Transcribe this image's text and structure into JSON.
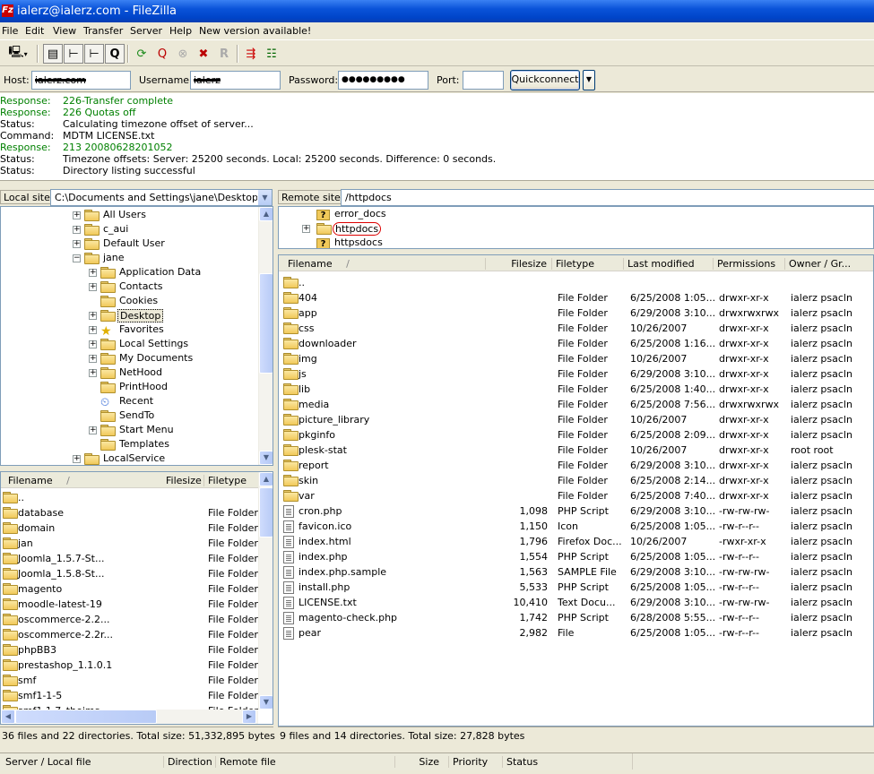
{
  "title": "ialerz@ialerz.com - FileZilla",
  "app_icon": "Fz",
  "menu": [
    "File",
    "Edit",
    "View",
    "Transfer",
    "Server",
    "Help",
    "New version available!"
  ],
  "toolbar_icons": [
    "site-manager-icon",
    "toggle-log-icon",
    "toggle-local-tree-icon",
    "toggle-remote-tree-icon",
    "toggle-queue-icon",
    "refresh-icon",
    "process-queue-icon",
    "cancel-icon",
    "disconnect-icon",
    "reconnect-icon",
    "compare-icon",
    "sync-browse-icon"
  ],
  "quickconnect": {
    "host_label": "Host:",
    "host_value": "ialerz.com",
    "username_label": "Username:",
    "username_value": "ialerz",
    "password_label": "Password:",
    "password_value": "●●●●●●●●●",
    "port_label": "Port:",
    "port_value": "",
    "button": "Quickconnect",
    "dropdown": "▼"
  },
  "log": [
    {
      "type": "Response:",
      "msg": "226-Transfer complete",
      "green": true
    },
    {
      "type": "Response:",
      "msg": "226 Quotas off",
      "green": true
    },
    {
      "type": "Status:",
      "msg": "Calculating timezone offset of server...",
      "green": false
    },
    {
      "type": "Command:",
      "msg": "MDTM LICENSE.txt",
      "green": false
    },
    {
      "type": "Response:",
      "msg": "213 20080628201052",
      "green": true
    },
    {
      "type": "Status:",
      "msg": "Timezone offsets: Server: 25200 seconds. Local: 25200 seconds. Difference: 0 seconds.",
      "green": false
    },
    {
      "type": "Status:",
      "msg": "Directory listing successful",
      "green": false
    }
  ],
  "local_site": {
    "label": "Local site:",
    "path": "C:\\Documents and Settings\\jane\\Desktop\\"
  },
  "remote_site": {
    "label": "Remote site:",
    "path": "/httpdocs"
  },
  "local_tree": [
    {
      "label": "All Users",
      "level": 0,
      "exp": "+",
      "icon": "folder"
    },
    {
      "label": "c_aui",
      "level": 0,
      "exp": "+",
      "icon": "folder"
    },
    {
      "label": "Default User",
      "level": 0,
      "exp": "+",
      "icon": "folder"
    },
    {
      "label": "jane",
      "level": 0,
      "exp": "−",
      "icon": "folder"
    },
    {
      "label": "Application Data",
      "level": 1,
      "exp": "+",
      "icon": "folder"
    },
    {
      "label": "Contacts",
      "level": 1,
      "exp": "+",
      "icon": "folder"
    },
    {
      "label": "Cookies",
      "level": 1,
      "exp": "",
      "icon": "folder"
    },
    {
      "label": "Desktop",
      "level": 1,
      "exp": "+",
      "icon": "folder",
      "selected": true
    },
    {
      "label": "Favorites",
      "level": 1,
      "exp": "+",
      "icon": "star"
    },
    {
      "label": "Local Settings",
      "level": 1,
      "exp": "+",
      "icon": "folder"
    },
    {
      "label": "My Documents",
      "level": 1,
      "exp": "+",
      "icon": "folder"
    },
    {
      "label": "NetHood",
      "level": 1,
      "exp": "+",
      "icon": "folder"
    },
    {
      "label": "PrintHood",
      "level": 1,
      "exp": "",
      "icon": "folder"
    },
    {
      "label": "Recent",
      "level": 1,
      "exp": "",
      "icon": "recent"
    },
    {
      "label": "SendTo",
      "level": 1,
      "exp": "",
      "icon": "folder"
    },
    {
      "label": "Start Menu",
      "level": 1,
      "exp": "+",
      "icon": "folder"
    },
    {
      "label": "Templates",
      "level": 1,
      "exp": "",
      "icon": "folder"
    },
    {
      "label": "LocalService",
      "level": 0,
      "exp": "+",
      "icon": "folder"
    }
  ],
  "remote_tree": [
    {
      "label": "error_docs",
      "exp": "",
      "icon": "question"
    },
    {
      "label": "httpdocs",
      "exp": "+",
      "icon": "folder",
      "circled": true
    },
    {
      "label": "httpsdocs",
      "exp": "",
      "icon": "question"
    }
  ],
  "local_list": {
    "headers": [
      "Filename",
      "Filesize",
      "Filetype"
    ],
    "sort_indicator": "/",
    "rows": [
      {
        "name": "..",
        "size": "",
        "type": ""
      },
      {
        "name": "database",
        "size": "",
        "type": "File Folder"
      },
      {
        "name": "domain",
        "size": "",
        "type": "File Folder"
      },
      {
        "name": "jan",
        "size": "",
        "type": "File Folder"
      },
      {
        "name": "Joomla_1.5.7-St...",
        "size": "",
        "type": "File Folder"
      },
      {
        "name": "Joomla_1.5.8-St...",
        "size": "",
        "type": "File Folder"
      },
      {
        "name": "magento",
        "size": "",
        "type": "File Folder"
      },
      {
        "name": "moodle-latest-19",
        "size": "",
        "type": "File Folder"
      },
      {
        "name": "oscommerce-2.2...",
        "size": "",
        "type": "File Folder"
      },
      {
        "name": "oscommerce-2.2r...",
        "size": "",
        "type": "File Folder"
      },
      {
        "name": "phpBB3",
        "size": "",
        "type": "File Folder"
      },
      {
        "name": "prestashop_1.1.0.1",
        "size": "",
        "type": "File Folder"
      },
      {
        "name": "smf",
        "size": "",
        "type": "File Folder"
      },
      {
        "name": "smf1-1-5",
        "size": "",
        "type": "File Folder"
      },
      {
        "name": "smf1.1.7_theims",
        "size": "",
        "type": "File Folder"
      }
    ],
    "status": "36 files and 22 directories. Total size: 51,332,895 bytes"
  },
  "remote_list": {
    "headers": [
      "Filename",
      "Filesize",
      "Filetype",
      "Last modified",
      "Permissions",
      "Owner / Gr..."
    ],
    "sort_indicator": "/",
    "rows": [
      {
        "name": "..",
        "size": "",
        "type": "",
        "modified": "",
        "perms": "",
        "owner": "",
        "icon": "folder"
      },
      {
        "name": "404",
        "size": "",
        "type": "File Folder",
        "modified": "6/25/2008 1:05...",
        "perms": "drwxr-xr-x",
        "owner": "ialerz psacln",
        "icon": "folder"
      },
      {
        "name": "app",
        "size": "",
        "type": "File Folder",
        "modified": "6/29/2008 3:10...",
        "perms": "drwxrwxrwx",
        "owner": "ialerz psacln",
        "icon": "folder"
      },
      {
        "name": "css",
        "size": "",
        "type": "File Folder",
        "modified": "10/26/2007",
        "perms": "drwxr-xr-x",
        "owner": "ialerz psacln",
        "icon": "folder"
      },
      {
        "name": "downloader",
        "size": "",
        "type": "File Folder",
        "modified": "6/25/2008 1:16...",
        "perms": "drwxr-xr-x",
        "owner": "ialerz psacln",
        "icon": "folder"
      },
      {
        "name": "img",
        "size": "",
        "type": "File Folder",
        "modified": "10/26/2007",
        "perms": "drwxr-xr-x",
        "owner": "ialerz psacln",
        "icon": "folder"
      },
      {
        "name": "js",
        "size": "",
        "type": "File Folder",
        "modified": "6/29/2008 3:10...",
        "perms": "drwxr-xr-x",
        "owner": "ialerz psacln",
        "icon": "folder"
      },
      {
        "name": "lib",
        "size": "",
        "type": "File Folder",
        "modified": "6/25/2008 1:40...",
        "perms": "drwxr-xr-x",
        "owner": "ialerz psacln",
        "icon": "folder"
      },
      {
        "name": "media",
        "size": "",
        "type": "File Folder",
        "modified": "6/25/2008 7:56...",
        "perms": "drwxrwxrwx",
        "owner": "ialerz psacln",
        "icon": "folder"
      },
      {
        "name": "picture_library",
        "size": "",
        "type": "File Folder",
        "modified": "10/26/2007",
        "perms": "drwxr-xr-x",
        "owner": "ialerz psacln",
        "icon": "folder"
      },
      {
        "name": "pkginfo",
        "size": "",
        "type": "File Folder",
        "modified": "6/25/2008 2:09...",
        "perms": "drwxr-xr-x",
        "owner": "ialerz psacln",
        "icon": "folder"
      },
      {
        "name": "plesk-stat",
        "size": "",
        "type": "File Folder",
        "modified": "10/26/2007",
        "perms": "drwxr-xr-x",
        "owner": "root root",
        "icon": "folder"
      },
      {
        "name": "report",
        "size": "",
        "type": "File Folder",
        "modified": "6/29/2008 3:10...",
        "perms": "drwxr-xr-x",
        "owner": "ialerz psacln",
        "icon": "folder"
      },
      {
        "name": "skin",
        "size": "",
        "type": "File Folder",
        "modified": "6/25/2008 2:14...",
        "perms": "drwxr-xr-x",
        "owner": "ialerz psacln",
        "icon": "folder"
      },
      {
        "name": "var",
        "size": "",
        "type": "File Folder",
        "modified": "6/25/2008 7:40...",
        "perms": "drwxr-xr-x",
        "owner": "ialerz psacln",
        "icon": "folder"
      },
      {
        "name": "cron.php",
        "size": "1,098",
        "type": "PHP Script",
        "modified": "6/29/2008 3:10...",
        "perms": "-rw-rw-rw-",
        "owner": "ialerz psacln",
        "icon": "file"
      },
      {
        "name": "favicon.ico",
        "size": "1,150",
        "type": "Icon",
        "modified": "6/25/2008 1:05...",
        "perms": "-rw-r--r--",
        "owner": "ialerz psacln",
        "icon": "file"
      },
      {
        "name": "index.html",
        "size": "1,796",
        "type": "Firefox Doc...",
        "modified": "10/26/2007",
        "perms": "-rwxr-xr-x",
        "owner": "ialerz psacln",
        "icon": "file"
      },
      {
        "name": "index.php",
        "size": "1,554",
        "type": "PHP Script",
        "modified": "6/25/2008 1:05...",
        "perms": "-rw-r--r--",
        "owner": "ialerz psacln",
        "icon": "file"
      },
      {
        "name": "index.php.sample",
        "size": "1,563",
        "type": "SAMPLE File",
        "modified": "6/29/2008 3:10...",
        "perms": "-rw-rw-rw-",
        "owner": "ialerz psacln",
        "icon": "file"
      },
      {
        "name": "install.php",
        "size": "5,533",
        "type": "PHP Script",
        "modified": "6/25/2008 1:05...",
        "perms": "-rw-r--r--",
        "owner": "ialerz psacln",
        "icon": "file"
      },
      {
        "name": "LICENSE.txt",
        "size": "10,410",
        "type": "Text Docu...",
        "modified": "6/29/2008 3:10...",
        "perms": "-rw-rw-rw-",
        "owner": "ialerz psacln",
        "icon": "file"
      },
      {
        "name": "magento-check.php",
        "size": "1,742",
        "type": "PHP Script",
        "modified": "6/28/2008 5:55...",
        "perms": "-rw-r--r--",
        "owner": "ialerz psacln",
        "icon": "file"
      },
      {
        "name": "pear",
        "size": "2,982",
        "type": "File",
        "modified": "6/25/2008 1:05...",
        "perms": "-rw-r--r--",
        "owner": "ialerz psacln",
        "icon": "file"
      }
    ],
    "status": "9 files and 14 directories. Total size: 27,828 bytes"
  },
  "queue_headers": [
    "Server / Local file",
    "Direction",
    "Remote file",
    "Size",
    "Priority",
    "Status"
  ]
}
